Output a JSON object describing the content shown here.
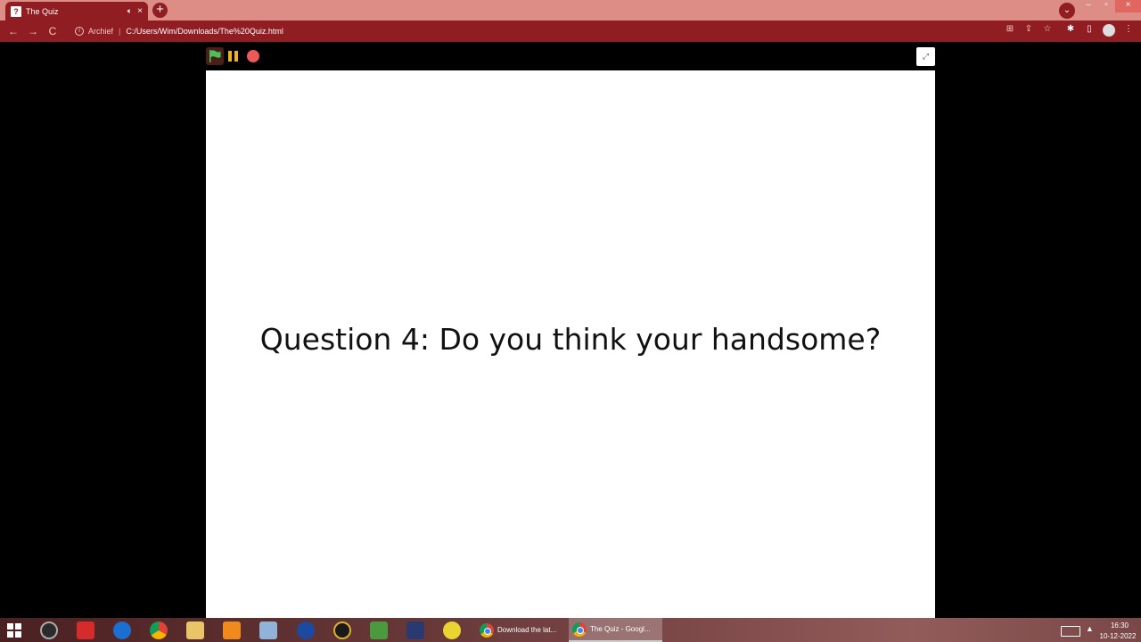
{
  "browser": {
    "tab": {
      "title": "The Quiz",
      "favicon": "?",
      "audio_icon": "speaker-icon",
      "close": "×"
    },
    "new_tab": "+",
    "tab_search": "⌄",
    "window": {
      "minimize": "–",
      "restore": "▫",
      "close": "×"
    },
    "nav": {
      "back": "←",
      "forward": "→",
      "reload": "C"
    },
    "site_info": {
      "icon": "i",
      "label": "Archief",
      "separator": "|"
    },
    "url": "C:/Users/Wim/Downloads/The%20Quiz.html",
    "toolbar_icons": {
      "translate": "⊞",
      "share": "⇪",
      "bookmark": "☆",
      "extensions": "✱",
      "side_panel": "▯",
      "menu": "⋮"
    }
  },
  "player": {
    "fullscreen": "⤢",
    "colors": {
      "flag": "#4cbf56",
      "pause": "#f2b21b",
      "stop": "#ec5959"
    }
  },
  "stage": {
    "question": "Question 4: Do you think your handsome?"
  },
  "taskbar": {
    "tasks": [
      {
        "label": "Download the lat..."
      },
      {
        "label": "The Quiz - Googl..."
      }
    ],
    "clock": {
      "time": "16:30",
      "date": "10-12-2022"
    }
  }
}
